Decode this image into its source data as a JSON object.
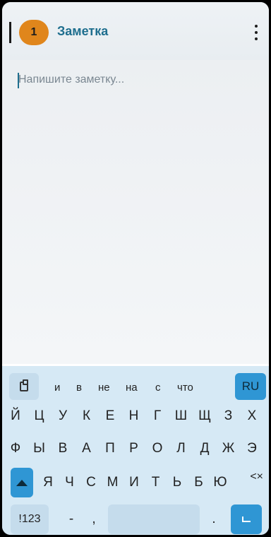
{
  "topbar": {
    "badge": "1",
    "title": "Заметка"
  },
  "editor": {
    "placeholder": "Напишите заметку..."
  },
  "keyboard": {
    "suggestions": [
      "и",
      "в",
      "не",
      "на",
      "с",
      "что"
    ],
    "language": "RU",
    "row1": [
      "Й",
      "Ц",
      "У",
      "К",
      "Е",
      "Н",
      "Г",
      "Ш",
      "Щ",
      "З",
      "Х"
    ],
    "row2": [
      "Ф",
      "Ы",
      "В",
      "А",
      "П",
      "Р",
      "О",
      "Л",
      "Д",
      "Ж",
      "Э"
    ],
    "row3": [
      "Я",
      "Ч",
      "С",
      "М",
      "И",
      "Т",
      "Ь",
      "Б",
      "Ю"
    ],
    "backspace": "<×",
    "numbers": "!123",
    "dash": "-",
    "comma": ",",
    "period": "."
  }
}
